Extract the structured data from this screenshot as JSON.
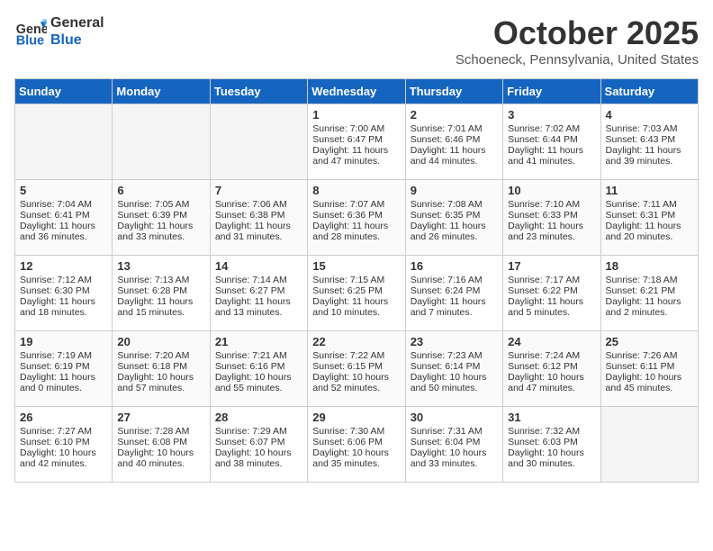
{
  "header": {
    "logo_line1": "General",
    "logo_line2": "Blue",
    "month": "October 2025",
    "location": "Schoeneck, Pennsylvania, United States"
  },
  "days_of_week": [
    "Sunday",
    "Monday",
    "Tuesday",
    "Wednesday",
    "Thursday",
    "Friday",
    "Saturday"
  ],
  "weeks": [
    [
      {
        "day": "",
        "empty": true
      },
      {
        "day": "",
        "empty": true
      },
      {
        "day": "",
        "empty": true
      },
      {
        "day": "1",
        "sunrise": "7:00 AM",
        "sunset": "6:47 PM",
        "daylight": "11 hours and 47 minutes."
      },
      {
        "day": "2",
        "sunrise": "7:01 AM",
        "sunset": "6:46 PM",
        "daylight": "11 hours and 44 minutes."
      },
      {
        "day": "3",
        "sunrise": "7:02 AM",
        "sunset": "6:44 PM",
        "daylight": "11 hours and 41 minutes."
      },
      {
        "day": "4",
        "sunrise": "7:03 AM",
        "sunset": "6:43 PM",
        "daylight": "11 hours and 39 minutes."
      }
    ],
    [
      {
        "day": "5",
        "sunrise": "7:04 AM",
        "sunset": "6:41 PM",
        "daylight": "11 hours and 36 minutes."
      },
      {
        "day": "6",
        "sunrise": "7:05 AM",
        "sunset": "6:39 PM",
        "daylight": "11 hours and 33 minutes."
      },
      {
        "day": "7",
        "sunrise": "7:06 AM",
        "sunset": "6:38 PM",
        "daylight": "11 hours and 31 minutes."
      },
      {
        "day": "8",
        "sunrise": "7:07 AM",
        "sunset": "6:36 PM",
        "daylight": "11 hours and 28 minutes."
      },
      {
        "day": "9",
        "sunrise": "7:08 AM",
        "sunset": "6:35 PM",
        "daylight": "11 hours and 26 minutes."
      },
      {
        "day": "10",
        "sunrise": "7:10 AM",
        "sunset": "6:33 PM",
        "daylight": "11 hours and 23 minutes."
      },
      {
        "day": "11",
        "sunrise": "7:11 AM",
        "sunset": "6:31 PM",
        "daylight": "11 hours and 20 minutes."
      }
    ],
    [
      {
        "day": "12",
        "sunrise": "7:12 AM",
        "sunset": "6:30 PM",
        "daylight": "11 hours and 18 minutes."
      },
      {
        "day": "13",
        "sunrise": "7:13 AM",
        "sunset": "6:28 PM",
        "daylight": "11 hours and 15 minutes."
      },
      {
        "day": "14",
        "sunrise": "7:14 AM",
        "sunset": "6:27 PM",
        "daylight": "11 hours and 13 minutes."
      },
      {
        "day": "15",
        "sunrise": "7:15 AM",
        "sunset": "6:25 PM",
        "daylight": "11 hours and 10 minutes."
      },
      {
        "day": "16",
        "sunrise": "7:16 AM",
        "sunset": "6:24 PM",
        "daylight": "11 hours and 7 minutes."
      },
      {
        "day": "17",
        "sunrise": "7:17 AM",
        "sunset": "6:22 PM",
        "daylight": "11 hours and 5 minutes."
      },
      {
        "day": "18",
        "sunrise": "7:18 AM",
        "sunset": "6:21 PM",
        "daylight": "11 hours and 2 minutes."
      }
    ],
    [
      {
        "day": "19",
        "sunrise": "7:19 AM",
        "sunset": "6:19 PM",
        "daylight": "11 hours and 0 minutes."
      },
      {
        "day": "20",
        "sunrise": "7:20 AM",
        "sunset": "6:18 PM",
        "daylight": "10 hours and 57 minutes."
      },
      {
        "day": "21",
        "sunrise": "7:21 AM",
        "sunset": "6:16 PM",
        "daylight": "10 hours and 55 minutes."
      },
      {
        "day": "22",
        "sunrise": "7:22 AM",
        "sunset": "6:15 PM",
        "daylight": "10 hours and 52 minutes."
      },
      {
        "day": "23",
        "sunrise": "7:23 AM",
        "sunset": "6:14 PM",
        "daylight": "10 hours and 50 minutes."
      },
      {
        "day": "24",
        "sunrise": "7:24 AM",
        "sunset": "6:12 PM",
        "daylight": "10 hours and 47 minutes."
      },
      {
        "day": "25",
        "sunrise": "7:26 AM",
        "sunset": "6:11 PM",
        "daylight": "10 hours and 45 minutes."
      }
    ],
    [
      {
        "day": "26",
        "sunrise": "7:27 AM",
        "sunset": "6:10 PM",
        "daylight": "10 hours and 42 minutes."
      },
      {
        "day": "27",
        "sunrise": "7:28 AM",
        "sunset": "6:08 PM",
        "daylight": "10 hours and 40 minutes."
      },
      {
        "day": "28",
        "sunrise": "7:29 AM",
        "sunset": "6:07 PM",
        "daylight": "10 hours and 38 minutes."
      },
      {
        "day": "29",
        "sunrise": "7:30 AM",
        "sunset": "6:06 PM",
        "daylight": "10 hours and 35 minutes."
      },
      {
        "day": "30",
        "sunrise": "7:31 AM",
        "sunset": "6:04 PM",
        "daylight": "10 hours and 33 minutes."
      },
      {
        "day": "31",
        "sunrise": "7:32 AM",
        "sunset": "6:03 PM",
        "daylight": "10 hours and 30 minutes."
      },
      {
        "day": "",
        "empty": true
      }
    ]
  ]
}
